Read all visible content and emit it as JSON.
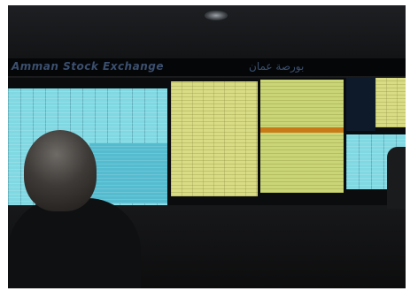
{
  "scene": {
    "banner_left_text": "Amman Stock Exchange",
    "banner_right_text": "بورصة عمان",
    "colors": {
      "cyan_board": "#7fd8e2",
      "yellow_board": "#d9dc84",
      "highlight_bar": "#c97a18",
      "banner_text": "#3b4f6e"
    }
  }
}
